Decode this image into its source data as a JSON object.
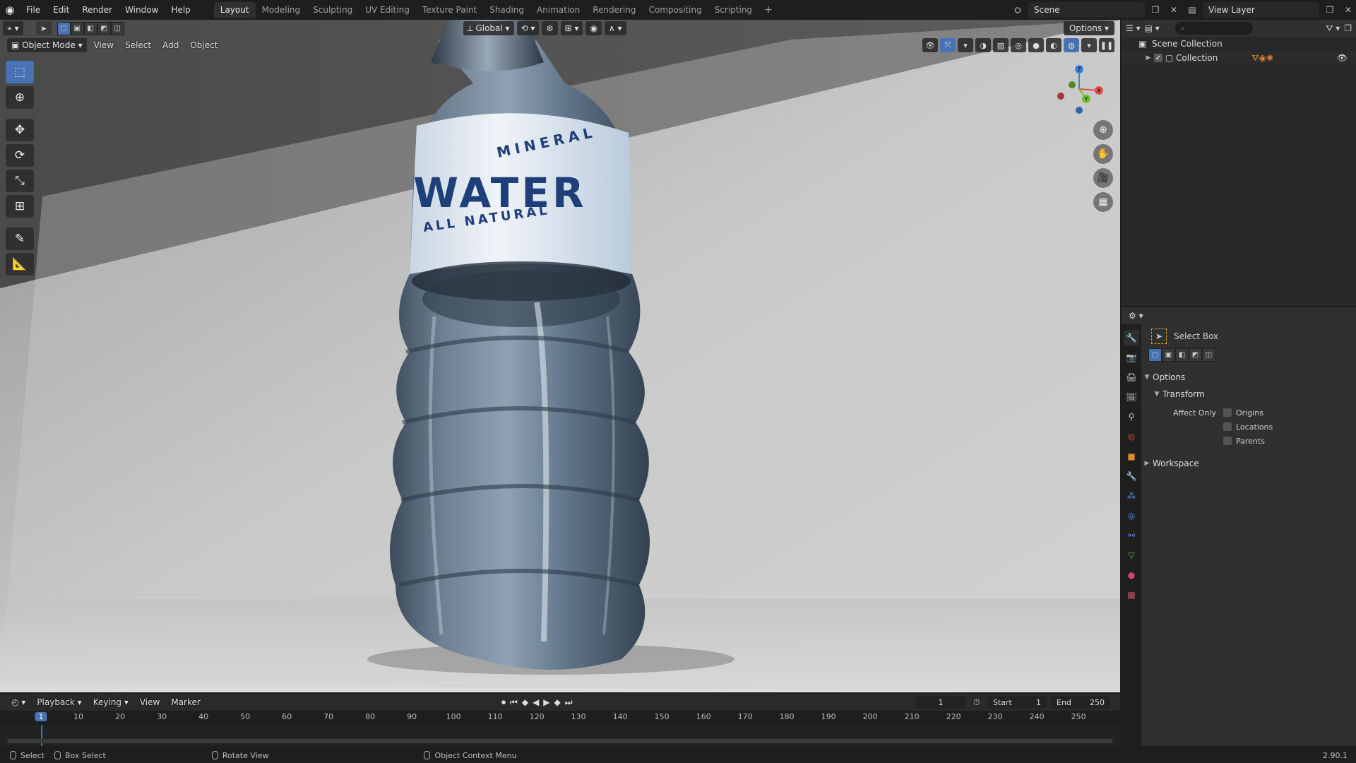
{
  "menubar": {
    "items": [
      "File",
      "Edit",
      "Render",
      "Window",
      "Help"
    ],
    "workspaces": [
      "Layout",
      "Modeling",
      "Sculpting",
      "UV Editing",
      "Texture Paint",
      "Shading",
      "Animation",
      "Rendering",
      "Compositing",
      "Scripting"
    ],
    "active_workspace": "Layout",
    "add_tab": "+",
    "scene": "Scene",
    "view_layer": "View Layer"
  },
  "viewport": {
    "mode": "Object Mode",
    "menus": [
      "View",
      "Select",
      "Add",
      "Object"
    ],
    "orientation": "Global",
    "options_label": "Options",
    "bottle_label": {
      "line1": "MINERAL",
      "line2": "WATER",
      "line3": "ALL NATURAL"
    },
    "gizmo": {
      "x": "X",
      "y": "Y",
      "z": "Z"
    },
    "colors": {
      "x_axis": "#e04c4c",
      "y_axis": "#6fbf2e",
      "z_axis": "#3f83e0",
      "accent": "#4772b3",
      "label_text": "#1f3f7a"
    }
  },
  "toolbar": {
    "tools": [
      "select-box-icon",
      "cursor-icon",
      "move-icon",
      "rotate-icon",
      "scale-icon",
      "transform-icon",
      "annotate-icon",
      "measure-icon"
    ]
  },
  "outliner": {
    "root": "Scene Collection",
    "collection": "Collection"
  },
  "properties": {
    "tool_name": "Select Box",
    "options_panel": "Options",
    "transform_panel": "Transform",
    "affect_only_label": "Affect Only",
    "checkboxes": [
      "Origins",
      "Locations",
      "Parents"
    ],
    "workspace_panel": "Workspace"
  },
  "timeline": {
    "menus": [
      "Playback",
      "Keying",
      "View",
      "Marker"
    ],
    "current_frame": "1",
    "start_label": "Start",
    "start_value": "1",
    "end_label": "End",
    "end_value": "250",
    "ticks": [
      "1",
      "10",
      "20",
      "30",
      "40",
      "50",
      "60",
      "70",
      "80",
      "90",
      "100",
      "110",
      "120",
      "130",
      "140",
      "150",
      "160",
      "170",
      "180",
      "190",
      "200",
      "210",
      "220",
      "230",
      "240",
      "250"
    ]
  },
  "statusbar": {
    "select": "Select",
    "box_select": "Box Select",
    "rotate_view": "Rotate View",
    "context_menu": "Object Context Menu",
    "version": "2.90.1"
  }
}
